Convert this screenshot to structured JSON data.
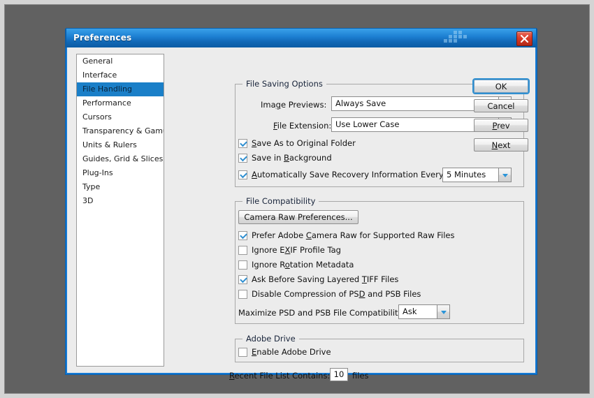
{
  "window": {
    "title": "Preferences",
    "close_icon": "close-icon",
    "titlebar_color": "#1d7fd2",
    "border_color": "#1479d4"
  },
  "sidebar": {
    "items": [
      {
        "label": "General",
        "selected": false
      },
      {
        "label": "Interface",
        "selected": false
      },
      {
        "label": "File Handling",
        "selected": true
      },
      {
        "label": "Performance",
        "selected": false
      },
      {
        "label": "Cursors",
        "selected": false
      },
      {
        "label": "Transparency & Gamut",
        "selected": false
      },
      {
        "label": "Units & Rulers",
        "selected": false
      },
      {
        "label": "Guides, Grid & Slices",
        "selected": false
      },
      {
        "label": "Plug-Ins",
        "selected": false
      },
      {
        "label": "Type",
        "selected": false
      },
      {
        "label": "3D",
        "selected": false
      }
    ],
    "selected_color": "#1a7fc8"
  },
  "file_saving": {
    "legend": "File Saving Options",
    "image_previews": {
      "label": "Image Previews:",
      "label_accel": "g",
      "value": "Always Save"
    },
    "file_extension": {
      "label": "File Extension:",
      "label_accel": "F",
      "value": "Use Lower Case"
    },
    "save_as_original": {
      "label": "Save As to Original Folder",
      "accel": "S",
      "checked": true
    },
    "save_background": {
      "label": "Save in Background",
      "accel": "B",
      "checked": true
    },
    "auto_recovery": {
      "label": "Automatically Save Recovery Information Every:",
      "accel": "A",
      "checked": true,
      "interval_value": "5 Minutes"
    }
  },
  "file_compatibility": {
    "legend": "File Compatibility",
    "camera_raw_button": "Camera Raw Preferences...",
    "checkboxes": [
      {
        "label": "Prefer Adobe Camera Raw for Supported Raw Files",
        "accel": "C",
        "checked": true
      },
      {
        "label": "Ignore EXIF Profile Tag",
        "accel": "X",
        "checked": false
      },
      {
        "label": "Ignore Rotation Metadata",
        "accel": "o",
        "checked": false
      },
      {
        "label": "Ask Before Saving Layered TIFF Files",
        "accel": "T",
        "checked": true
      },
      {
        "label": "Disable Compression of PSD and PSB Files",
        "accel": "D",
        "checked": false
      }
    ],
    "maximize": {
      "label": "Maximize PSD and PSB File Compatibility:",
      "value": "Ask"
    }
  },
  "adobe_drive": {
    "legend": "Adobe Drive",
    "enable": {
      "label": "Enable Adobe Drive",
      "accel": "E",
      "checked": false
    }
  },
  "recent_files": {
    "label": "Recent File List Contains:",
    "accel": "R",
    "value": "10",
    "suffix": "files"
  },
  "buttons": {
    "ok": "OK",
    "cancel": "Cancel",
    "prev": "Prev",
    "prev_accel": "P",
    "next": "Next",
    "next_accel": "N"
  }
}
